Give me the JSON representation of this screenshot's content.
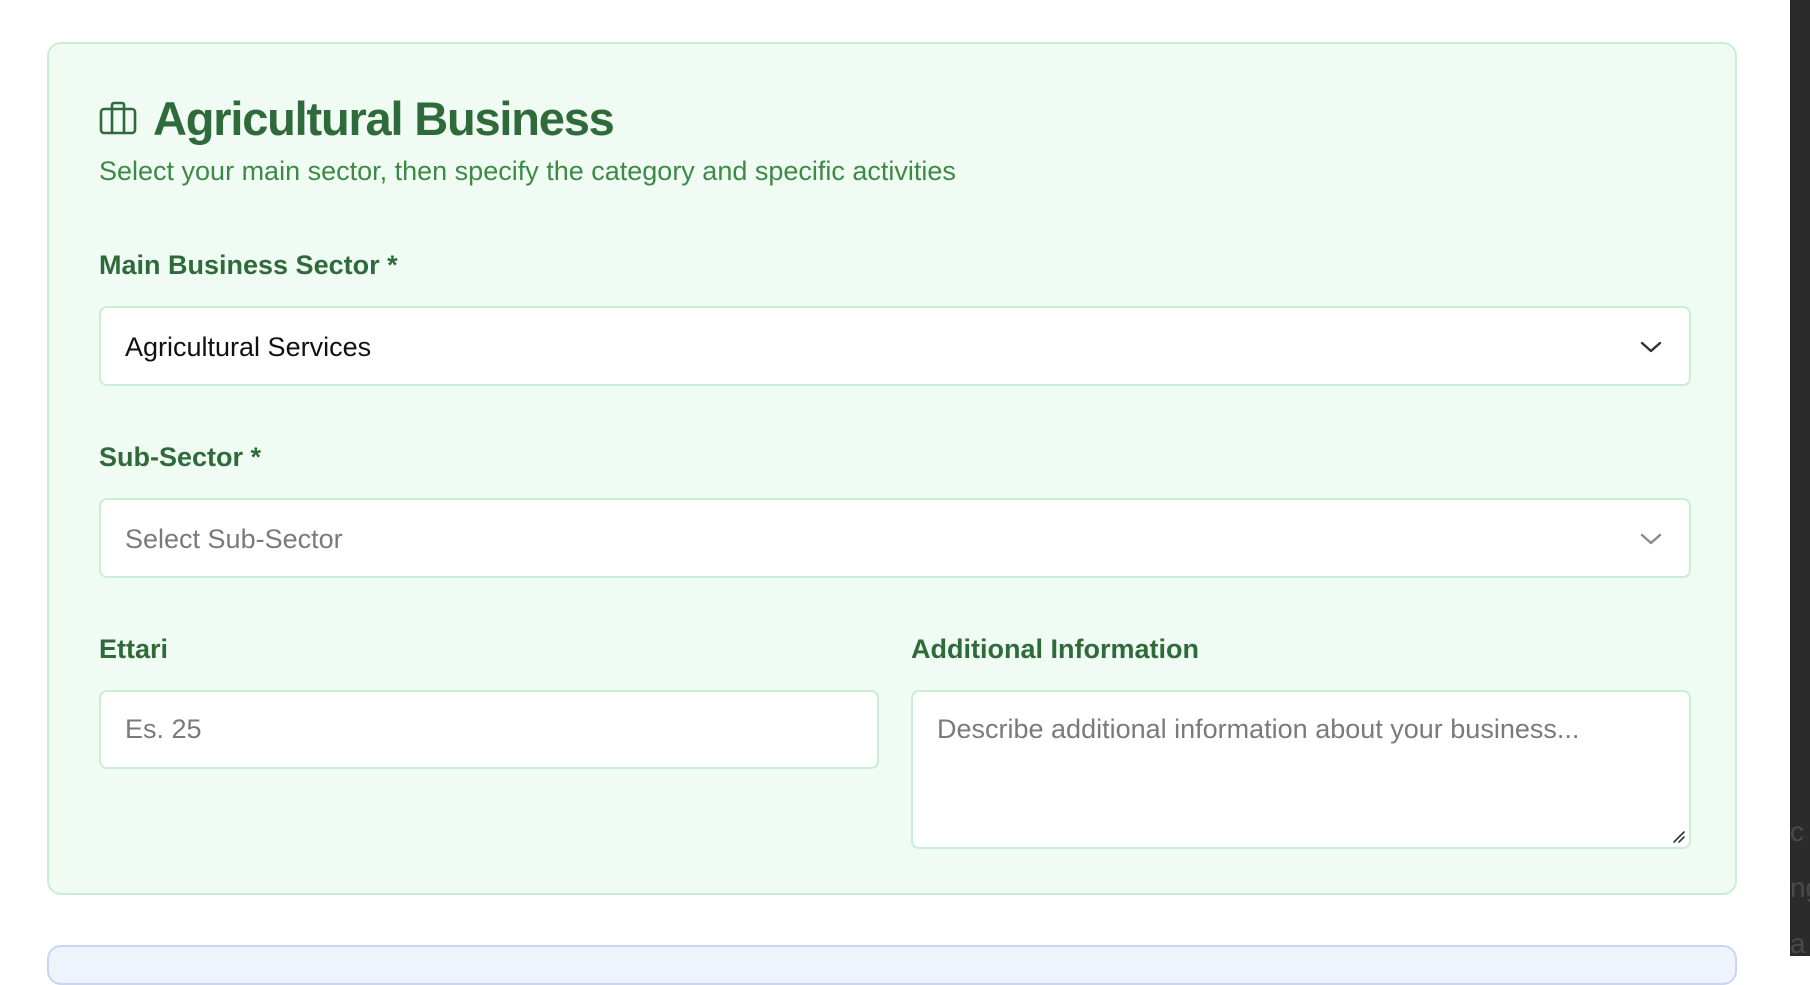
{
  "section": {
    "title": "Agricultural Business",
    "subtitle": "Select your main sector, then specify the category and specific activities",
    "icon": "briefcase-icon"
  },
  "main_sector": {
    "label": "Main Business Sector *",
    "selected": "Agricultural Services",
    "icon": "chevron-down-icon"
  },
  "sub_sector": {
    "label": "Sub-Sector *",
    "placeholder": "Select Sub-Sector",
    "icon": "chevron-down-icon"
  },
  "ettari": {
    "label": "Ettari",
    "value": "",
    "placeholder": "Es. 25"
  },
  "additional_info": {
    "label": "Additional Information",
    "value": "",
    "placeholder": "Describe additional information about your business..."
  },
  "edge_fragments": [
    "c",
    "ng",
    "a"
  ],
  "colors": {
    "heading": "#2f6a3a",
    "subtitle": "#3c8a45",
    "card_bg": "#f0fbf3",
    "card_border": "#c8efd4",
    "placeholder": "#7a7a7a",
    "next_card_bg": "#eef3fc",
    "next_card_border": "#c9d6f2"
  }
}
